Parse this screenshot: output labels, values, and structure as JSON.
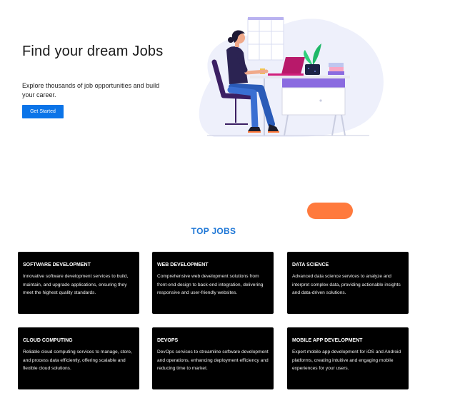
{
  "hero": {
    "title": "Find your dream Jobs",
    "subtitle": "Explore thousands of job opportunities and build your career.",
    "cta_label": "Get Started"
  },
  "top_jobs": {
    "heading": "TOP JOBS",
    "cards": [
      {
        "title": "SOFTWARE DEVELOPMENT",
        "description": "Innovative software development services to build, maintain, and upgrade applications, ensuring they meet the highest quality standards."
      },
      {
        "title": "WEB DEVELOPMENT",
        "description": "Comprehensive web development solutions from front-end design to back-end integration, delivering responsive and user-friendly websites."
      },
      {
        "title": "DATA SCIENCE",
        "description": "Advanced data science services to analyze and interpret complex data, providing actionable insights and data-driven solutions."
      },
      {
        "title": "CLOUD COMPUTING",
        "description": "Reliable cloud computing services to manage, store, and process data efficiently, offering scalable and flexible cloud solutions."
      },
      {
        "title": "DEVOPS",
        "description": "DevOps services to streamline software development and operations, enhancing deployment efficiency and reducing time to market."
      },
      {
        "title": "MOBILE APP DEVELOPMENT",
        "description": "Expert mobile app development for iOS and Android platforms, creating intuitive and engaging mobile experiences for your users."
      }
    ]
  },
  "colors": {
    "primary": "#0b74e8",
    "heading_blue": "#1d76d6",
    "accent_orange": "#ff7a3d",
    "card_bg": "#000000"
  }
}
